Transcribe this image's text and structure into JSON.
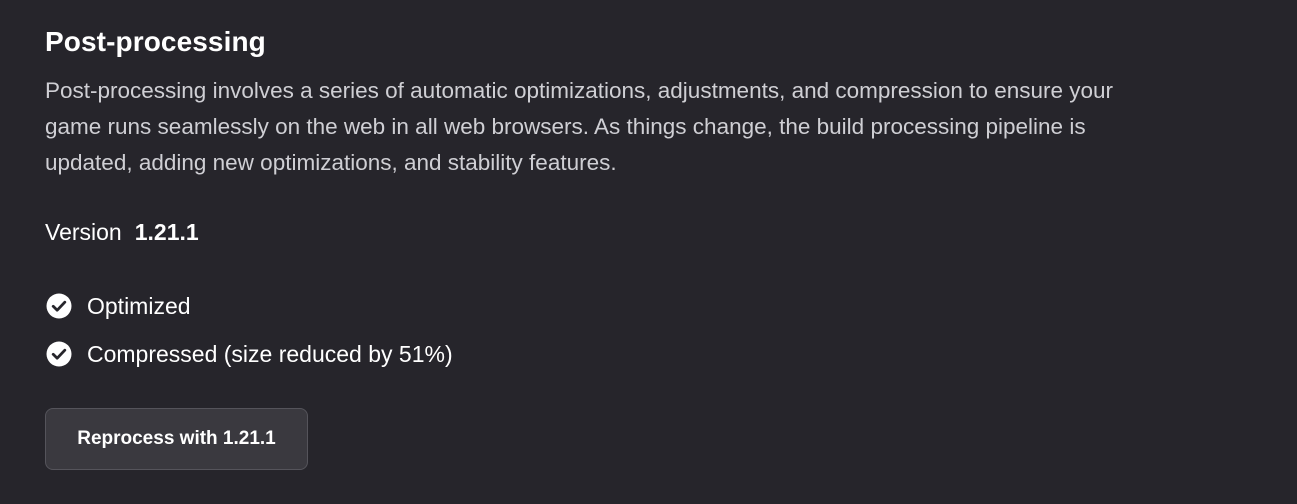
{
  "section": {
    "title": "Post-processing",
    "description": "Post-processing involves a series of automatic optimizations, adjustments, and compression to ensure your game runs seamlessly on the web in all web browsers. As things change, the build processing pipeline is updated, adding new optimizations, and stability features."
  },
  "version": {
    "label": "Version",
    "value": "1.21.1"
  },
  "status_items": [
    {
      "icon": "check-circle-icon",
      "label": "Optimized"
    },
    {
      "icon": "check-circle-icon",
      "label": "Compressed (size reduced by 51%)"
    }
  ],
  "actions": {
    "reprocess_label": "Reprocess with 1.21.1"
  },
  "colors": {
    "background": "#26252b",
    "button_bg": "#3a393f",
    "text": "#ffffff",
    "muted_text": "#cfcfd4"
  }
}
